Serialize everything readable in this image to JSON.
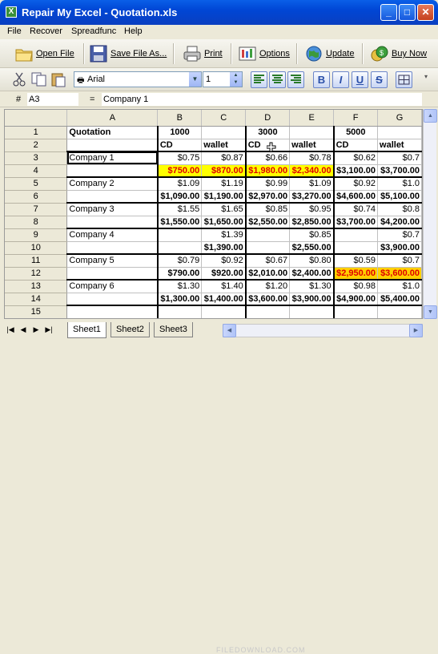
{
  "window": {
    "title": "Repair My Excel - Quotation.xls",
    "minimize": "_",
    "maximize": "□",
    "close": "✕"
  },
  "menu": [
    "File",
    "Recover",
    "Spreadfunc",
    "Help"
  ],
  "toolbar": {
    "open": "Open File",
    "save": "Save File As...",
    "print": "Print",
    "options": "Options",
    "update": "Update",
    "buy": "Buy Now"
  },
  "format": {
    "font": "Arial",
    "size": "1",
    "bold": "B",
    "italic": "I",
    "underline": "U",
    "strike": "S"
  },
  "formula_bar": {
    "hash": "#",
    "cell_ref": "A3",
    "eq": "=",
    "content": "Company 1"
  },
  "grid": {
    "columns": [
      "A",
      "B",
      "C",
      "D",
      "E",
      "F",
      "G"
    ],
    "rows": [
      [
        "Quotation",
        "1000",
        "",
        "3000",
        "",
        "5000",
        ""
      ],
      [
        "",
        "CD",
        "wallet",
        "CD",
        "wallet",
        "CD",
        "wallet"
      ],
      [
        "Company 1",
        "$0.75",
        "$0.87",
        "$0.66",
        "$0.78",
        "$0.62",
        "$0.7"
      ],
      [
        "",
        "$750.00",
        "$870.00",
        "$1,980.00",
        "$2,340.00",
        "$3,100.00",
        "$3,700.00"
      ],
      [
        "Company 2",
        "$1.09",
        "$1.19",
        "$0.99",
        "$1.09",
        "$0.92",
        "$1.0"
      ],
      [
        "",
        "$1,090.00",
        "$1,190.00",
        "$2,970.00",
        "$3,270.00",
        "$4,600.00",
        "$5,100.00"
      ],
      [
        "Company 3",
        "$1.55",
        "$1.65",
        "$0.85",
        "$0.95",
        "$0.74",
        "$0.8"
      ],
      [
        "",
        "$1,550.00",
        "$1,650.00",
        "$2,550.00",
        "$2,850.00",
        "$3,700.00",
        "$4,200.00"
      ],
      [
        "Company 4",
        "",
        "$1.39",
        "",
        "$0.85",
        "",
        "$0.7"
      ],
      [
        "",
        "",
        "$1,390.00",
        "",
        "$2,550.00",
        "",
        "$3,900.00"
      ],
      [
        "Company 5",
        "$0.79",
        "$0.92",
        "$0.67",
        "$0.80",
        "$0.59",
        "$0.7"
      ],
      [
        "",
        "$790.00",
        "$920.00",
        "$2,010.00",
        "$2,400.00",
        "$2,950.00",
        "$3,600.00"
      ],
      [
        "Company 6",
        "$1.30",
        "$1.40",
        "$1.20",
        "$1.30",
        "$0.98",
        "$1.0"
      ],
      [
        "",
        "$1,300.00",
        "$1,400.00",
        "$3,600.00",
        "$3,900.00",
        "$4,900.00",
        "$5,400.00"
      ],
      [
        "",
        "",
        "",
        "",
        "",
        "",
        ""
      ],
      [
        "",
        "",
        "",
        "",
        "",
        "",
        ""
      ]
    ],
    "highlight_yellow": "#ffff00",
    "highlight_orange": "#ffd000",
    "highlight_text": "#e00000"
  },
  "sheets": [
    "Sheet1",
    "Sheet2",
    "Sheet3"
  ],
  "watermark": "FILEDOWNLOAD.COM",
  "colors": {
    "titlebar": "#0046d5",
    "face": "#ece9d8"
  }
}
